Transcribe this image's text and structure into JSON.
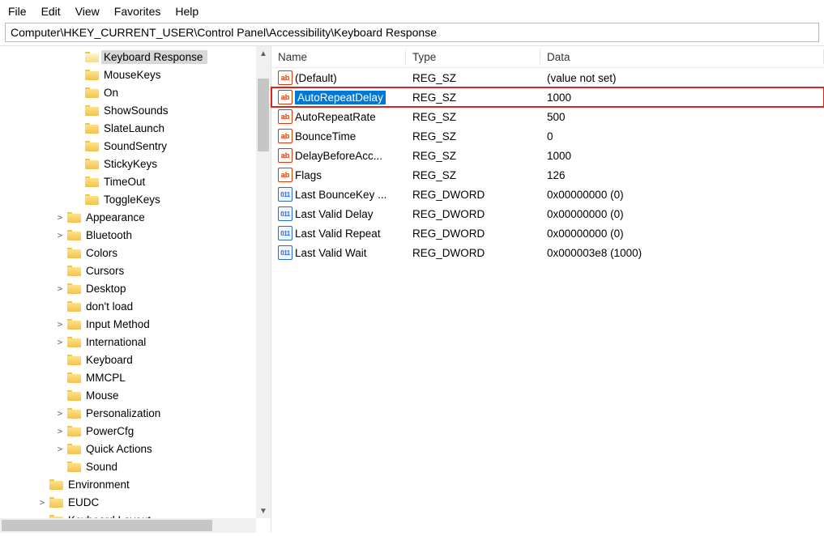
{
  "menu": {
    "file": "File",
    "edit": "Edit",
    "view": "View",
    "favorites": "Favorites",
    "help": "Help"
  },
  "address": "Computer\\HKEY_CURRENT_USER\\Control Panel\\Accessibility\\Keyboard Response",
  "columns": {
    "name": "Name",
    "type": "Type",
    "data": "Data"
  },
  "tree": [
    {
      "indent": 4,
      "expand": "",
      "label": "Keyboard Response",
      "selected": true,
      "open": true
    },
    {
      "indent": 4,
      "expand": "",
      "label": "MouseKeys"
    },
    {
      "indent": 4,
      "expand": "",
      "label": "On"
    },
    {
      "indent": 4,
      "expand": "",
      "label": "ShowSounds"
    },
    {
      "indent": 4,
      "expand": "",
      "label": "SlateLaunch"
    },
    {
      "indent": 4,
      "expand": "",
      "label": "SoundSentry"
    },
    {
      "indent": 4,
      "expand": "",
      "label": "StickyKeys"
    },
    {
      "indent": 4,
      "expand": "",
      "label": "TimeOut"
    },
    {
      "indent": 4,
      "expand": "",
      "label": "ToggleKeys"
    },
    {
      "indent": 3,
      "expand": ">",
      "label": "Appearance"
    },
    {
      "indent": 3,
      "expand": ">",
      "label": "Bluetooth"
    },
    {
      "indent": 3,
      "expand": "",
      "label": "Colors"
    },
    {
      "indent": 3,
      "expand": "",
      "label": "Cursors"
    },
    {
      "indent": 3,
      "expand": ">",
      "label": "Desktop"
    },
    {
      "indent": 3,
      "expand": "",
      "label": "don't load"
    },
    {
      "indent": 3,
      "expand": ">",
      "label": "Input Method"
    },
    {
      "indent": 3,
      "expand": ">",
      "label": "International"
    },
    {
      "indent": 3,
      "expand": "",
      "label": "Keyboard"
    },
    {
      "indent": 3,
      "expand": "",
      "label": "MMCPL"
    },
    {
      "indent": 3,
      "expand": "",
      "label": "Mouse"
    },
    {
      "indent": 3,
      "expand": ">",
      "label": "Personalization"
    },
    {
      "indent": 3,
      "expand": ">",
      "label": "PowerCfg"
    },
    {
      "indent": 3,
      "expand": ">",
      "label": "Quick Actions"
    },
    {
      "indent": 3,
      "expand": "",
      "label": "Sound"
    },
    {
      "indent": 2,
      "expand": "",
      "label": "Environment"
    },
    {
      "indent": 2,
      "expand": ">",
      "label": "EUDC"
    },
    {
      "indent": 2,
      "expand": ">",
      "label": "Keyboard Layout"
    }
  ],
  "values": [
    {
      "icon": "sz",
      "name": "(Default)",
      "type": "REG_SZ",
      "data": "(value not set)"
    },
    {
      "icon": "sz",
      "name": "AutoRepeatDelay",
      "type": "REG_SZ",
      "data": "1000",
      "selected": true,
      "highlight": true
    },
    {
      "icon": "sz",
      "name": "AutoRepeatRate",
      "type": "REG_SZ",
      "data": "500"
    },
    {
      "icon": "sz",
      "name": "BounceTime",
      "type": "REG_SZ",
      "data": "0"
    },
    {
      "icon": "sz",
      "name": "DelayBeforeAcc...",
      "type": "REG_SZ",
      "data": "1000"
    },
    {
      "icon": "sz",
      "name": "Flags",
      "type": "REG_SZ",
      "data": "126"
    },
    {
      "icon": "dw",
      "name": "Last BounceKey ...",
      "type": "REG_DWORD",
      "data": "0x00000000 (0)"
    },
    {
      "icon": "dw",
      "name": "Last Valid Delay",
      "type": "REG_DWORD",
      "data": "0x00000000 (0)"
    },
    {
      "icon": "dw",
      "name": "Last Valid Repeat",
      "type": "REG_DWORD",
      "data": "0x00000000 (0)"
    },
    {
      "icon": "dw",
      "name": "Last Valid Wait",
      "type": "REG_DWORD",
      "data": "0x000003e8 (1000)"
    }
  ],
  "iconText": {
    "sz": "ab",
    "dw": "011"
  }
}
